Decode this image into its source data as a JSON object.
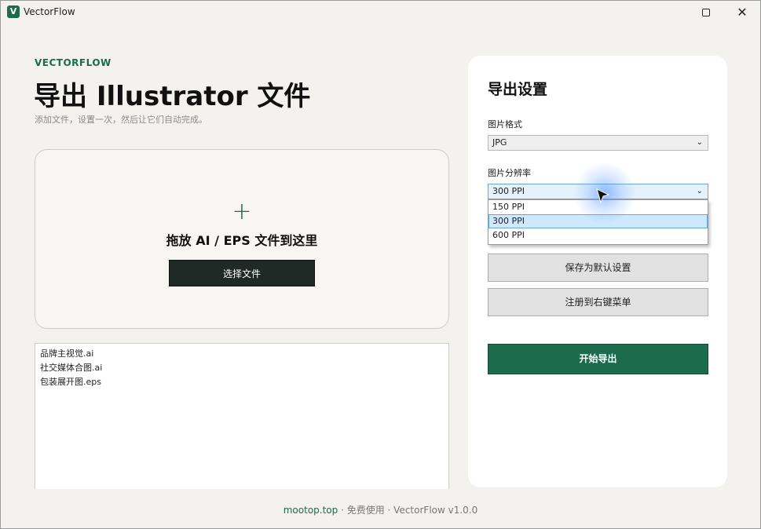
{
  "window": {
    "title": "VectorFlow",
    "icon_letter": "V",
    "close_glyph": "✕"
  },
  "header": {
    "brand": "VECTORFLOW",
    "title": "导出 Illustrator 文件",
    "subtitle": "添加文件，设置一次，然后让它们自动完成。"
  },
  "dropzone": {
    "plus_glyph": "+",
    "label": "拖放 AI / EPS 文件到这里",
    "choose_button": "选择文件"
  },
  "files": [
    "品牌主视觉.ai",
    "社交媒体合图.ai",
    "包装展开图.eps"
  ],
  "settings": {
    "title": "导出设置",
    "format_label": "图片格式",
    "format_value": "JPG",
    "resolution_label": "图片分辨率",
    "resolution_value": "300 PPI",
    "resolution_options": [
      "150 PPI",
      "300 PPI",
      "600 PPI"
    ],
    "save_default_button": "保存为默认设置",
    "register_menu_button": "注册到右键菜单",
    "export_button": "开始导出",
    "chevron_glyph": "⌄"
  },
  "footer": {
    "link": "mootop.top",
    "sep": " · ",
    "free": "免费使用",
    "version": "VectorFlow v1.0.0"
  },
  "colors": {
    "accent": "#1b6b4c",
    "dark_button": "#1f2a26",
    "background": "#f3f2ee"
  }
}
